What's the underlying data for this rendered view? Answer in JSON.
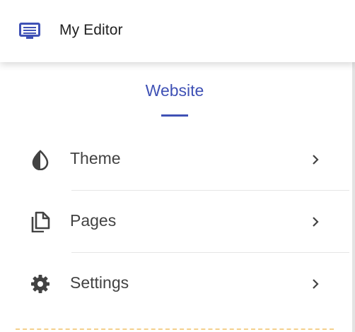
{
  "app_bar": {
    "title": "My Editor",
    "icon": "web-editor-icon",
    "accent_color": "#3f51b5"
  },
  "section": {
    "title": "Website"
  },
  "menu": {
    "items": [
      {
        "label": "Theme",
        "icon": "theme-icon"
      },
      {
        "label": "Pages",
        "icon": "pages-icon"
      },
      {
        "label": "Settings",
        "icon": "gear-icon"
      }
    ]
  }
}
